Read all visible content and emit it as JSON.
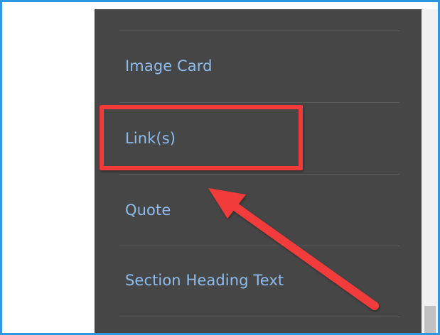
{
  "menu": {
    "items": [
      {
        "label": "Image Card"
      },
      {
        "label": "Link(s)"
      },
      {
        "label": "Quote"
      },
      {
        "label": "Section Heading Text"
      }
    ]
  },
  "annotation": {
    "highlighted_item": "Link(s)",
    "color": "#f23a3a"
  },
  "colors": {
    "border": "#2f97e2",
    "menu_background": "#464646",
    "menu_text": "#8dbcef"
  }
}
